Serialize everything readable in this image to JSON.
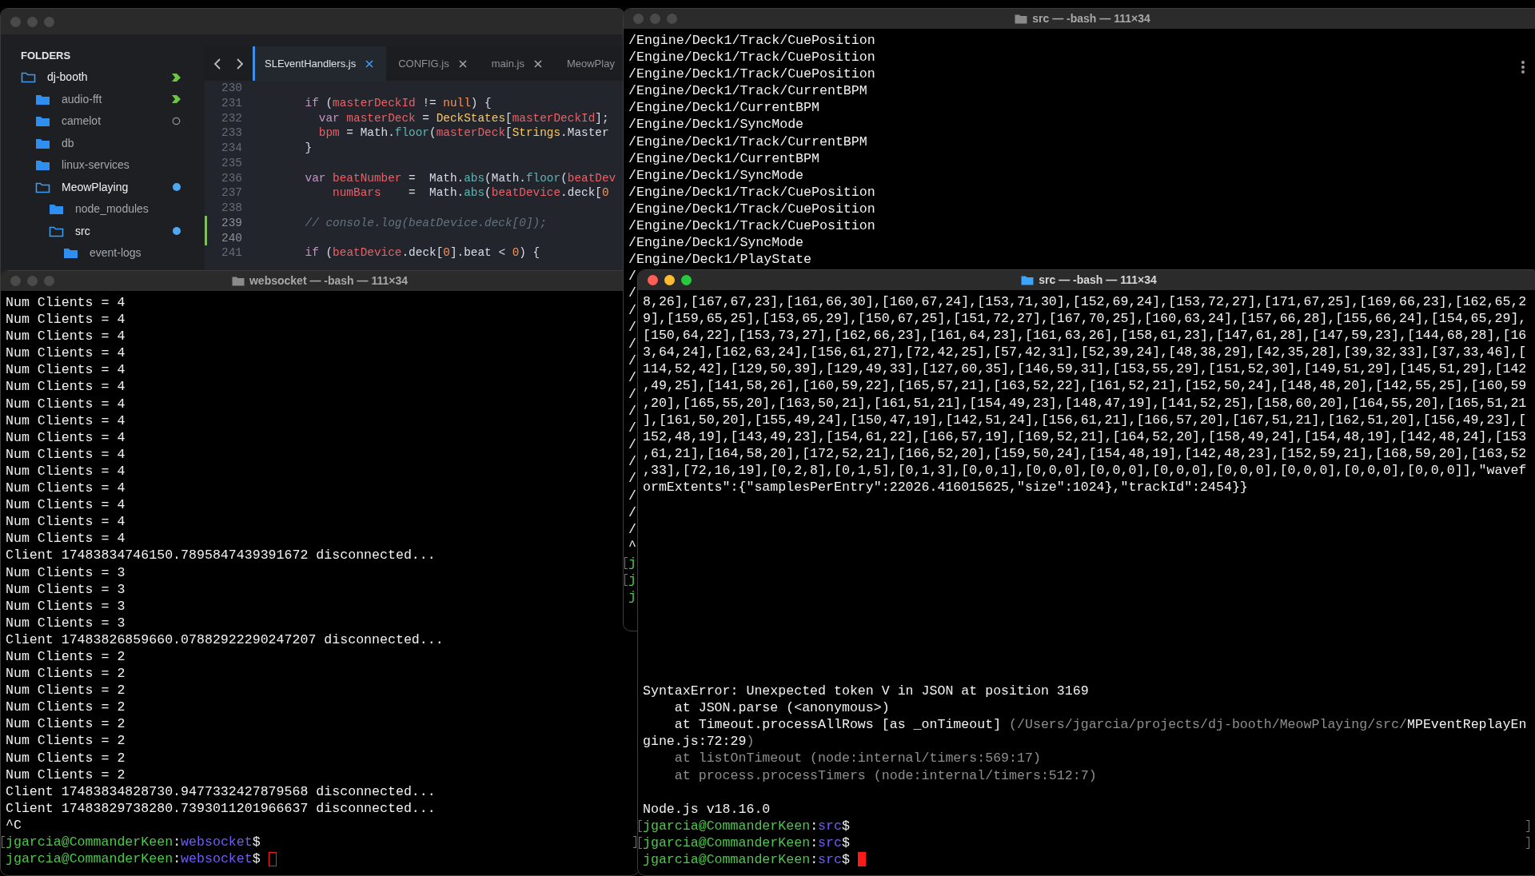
{
  "editor_window": {
    "active": false,
    "sidebar": {
      "heading": "FOLDERS",
      "tree": [
        {
          "label": "dj-booth",
          "expanded": true,
          "badge": {
            "kind": "arrow"
          },
          "children": [
            {
              "label": "audio-fft",
              "expanded": false,
              "badge": {
                "kind": "arrow"
              }
            },
            {
              "label": "camelot",
              "expanded": false,
              "badge": {
                "kind": "circle"
              }
            },
            {
              "label": "db",
              "expanded": false
            },
            {
              "label": "linux-services",
              "expanded": false
            },
            {
              "label": "MeowPlaying",
              "expanded": true,
              "badge": {
                "kind": "dot"
              },
              "children": [
                {
                  "label": "node_modules",
                  "expanded": false
                },
                {
                  "label": "src",
                  "expanded": true,
                  "badge": {
                    "kind": "dot"
                  },
                  "children": [
                    {
                      "label": "event-logs",
                      "expanded": false
                    }
                  ]
                }
              ]
            }
          ]
        }
      ]
    },
    "tabs": [
      {
        "label": "SLEventHandlers.js",
        "selected": true,
        "closable": true
      },
      {
        "label": "CONFIG.js",
        "selected": false,
        "closable": true
      },
      {
        "label": "main.js",
        "selected": false,
        "closable": true
      },
      {
        "label": "MeowPlay",
        "selected": false,
        "closable": false
      }
    ],
    "code_lines": [
      {
        "number": "230",
        "modified": false
      },
      {
        "number": "231",
        "modified": false,
        "tokens": [
          {
            "kind": "keyword",
            "text": "    if"
          },
          {
            "kind": "plain",
            "text": " ("
          },
          {
            "kind": "variable",
            "text": "masterDeckId"
          },
          {
            "kind": "plain",
            "text": " != "
          },
          {
            "kind": "constant",
            "text": "null"
          },
          {
            "kind": "plain",
            "text": ") {"
          }
        ]
      },
      {
        "number": "232",
        "modified": false,
        "tokens": [
          {
            "kind": "keyword",
            "text": "      var"
          },
          {
            "kind": "variable",
            "text": " masterDeck"
          },
          {
            "kind": "plain",
            "text": " = "
          },
          {
            "kind": "class",
            "text": "DeckStates"
          },
          {
            "kind": "plain",
            "text": "["
          },
          {
            "kind": "variable",
            "text": "masterDeckId"
          },
          {
            "kind": "plain",
            "text": "];"
          }
        ]
      },
      {
        "number": "233",
        "modified": false,
        "tokens": [
          {
            "kind": "variable",
            "text": "      bpm"
          },
          {
            "kind": "plain",
            "text": " = Math."
          },
          {
            "kind": "function",
            "text": "floor"
          },
          {
            "kind": "plain",
            "text": "("
          },
          {
            "kind": "variable",
            "text": "masterDeck"
          },
          {
            "kind": "plain",
            "text": "["
          },
          {
            "kind": "class",
            "text": "Strings"
          },
          {
            "kind": "plain",
            "text": ".Master"
          }
        ]
      },
      {
        "number": "234",
        "modified": false,
        "tokens": [
          {
            "kind": "plain",
            "text": "    }"
          }
        ]
      },
      {
        "number": "235",
        "modified": false
      },
      {
        "number": "236",
        "modified": false,
        "tokens": [
          {
            "kind": "keyword",
            "text": "    var"
          },
          {
            "kind": "variable",
            "text": " beatNumber"
          },
          {
            "kind": "plain",
            "text": " =  Math."
          },
          {
            "kind": "function",
            "text": "abs"
          },
          {
            "kind": "plain",
            "text": "(Math."
          },
          {
            "kind": "function",
            "text": "floor"
          },
          {
            "kind": "plain",
            "text": "("
          },
          {
            "kind": "variable",
            "text": "beatDev"
          }
        ]
      },
      {
        "number": "237",
        "modified": false,
        "tokens": [
          {
            "kind": "variable",
            "text": "        numBars"
          },
          {
            "kind": "plain",
            "text": "    =  Math."
          },
          {
            "kind": "function",
            "text": "abs"
          },
          {
            "kind": "plain",
            "text": "("
          },
          {
            "kind": "variable",
            "text": "beatDevice"
          },
          {
            "kind": "plain",
            "text": ".deck["
          },
          {
            "kind": "constant",
            "text": "0"
          }
        ]
      },
      {
        "number": "238",
        "modified": false
      },
      {
        "number": "239",
        "modified": true,
        "tokens": [
          {
            "kind": "comment",
            "text": "    // console.log(beatDevice.deck[0]);"
          }
        ]
      },
      {
        "number": "240",
        "modified": true
      },
      {
        "number": "241",
        "modified": false,
        "tokens": [
          {
            "kind": "keyword",
            "text": "    if"
          },
          {
            "kind": "plain",
            "text": " ("
          },
          {
            "kind": "variable",
            "text": "beatDevice"
          },
          {
            "kind": "plain",
            "text": ".deck["
          },
          {
            "kind": "constant",
            "text": "0"
          },
          {
            "kind": "plain",
            "text": "].beat < "
          },
          {
            "kind": "constant",
            "text": "0"
          },
          {
            "kind": "plain",
            "text": ") {"
          }
        ]
      }
    ]
  },
  "terminal_top_right": {
    "title": "src — -bash — 111×34",
    "active": false,
    "lines": [
      {
        "kind": "output",
        "dim": false,
        "text": "/Engine/Deck1/Track/CuePosition"
      },
      {
        "kind": "output",
        "dim": false,
        "text": "/Engine/Deck1/Track/CuePosition"
      },
      {
        "kind": "output",
        "dim": false,
        "text": "/Engine/Deck1/Track/CuePosition"
      },
      {
        "kind": "output",
        "dim": false,
        "text": "/Engine/Deck1/Track/CurrentBPM"
      },
      {
        "kind": "output",
        "dim": false,
        "text": "/Engine/Deck1/CurrentBPM"
      },
      {
        "kind": "output",
        "dim": false,
        "text": "/Engine/Deck1/SyncMode"
      },
      {
        "kind": "output",
        "dim": false,
        "text": "/Engine/Deck1/Track/CurrentBPM"
      },
      {
        "kind": "output",
        "dim": false,
        "text": "/Engine/Deck1/CurrentBPM"
      },
      {
        "kind": "output",
        "dim": false,
        "text": "/Engine/Deck1/SyncMode"
      },
      {
        "kind": "output",
        "dim": false,
        "text": "/Engine/Deck1/Track/CuePosition"
      },
      {
        "kind": "output",
        "dim": false,
        "text": "/Engine/Deck1/Track/CuePosition"
      },
      {
        "kind": "output",
        "dim": false,
        "text": "/Engine/Deck1/Track/CuePosition"
      },
      {
        "kind": "output",
        "dim": false,
        "text": "/Engine/Deck1/SyncMode"
      },
      {
        "kind": "output",
        "dim": false,
        "text": "/Engine/Deck1/PlayState"
      },
      {
        "kind": "output",
        "dim": false,
        "text": "/"
      },
      {
        "kind": "output",
        "dim": false,
        "text": "/"
      },
      {
        "kind": "output",
        "dim": false,
        "text": "/"
      },
      {
        "kind": "output",
        "dim": false,
        "text": "/"
      },
      {
        "kind": "output",
        "dim": false,
        "text": "/"
      },
      {
        "kind": "output",
        "dim": false,
        "text": "/"
      },
      {
        "kind": "output",
        "dim": false,
        "text": "/"
      },
      {
        "kind": "output",
        "dim": false,
        "text": "/"
      },
      {
        "kind": "output",
        "dim": false,
        "text": "/"
      },
      {
        "kind": "output",
        "dim": false,
        "text": "/"
      },
      {
        "kind": "output",
        "dim": false,
        "text": "/"
      },
      {
        "kind": "output",
        "dim": false,
        "text": "/"
      },
      {
        "kind": "output",
        "dim": false,
        "text": "/"
      },
      {
        "kind": "output",
        "dim": false,
        "text": "/"
      },
      {
        "kind": "output",
        "dim": false,
        "text": "/"
      },
      {
        "kind": "output",
        "dim": false,
        "text": "/"
      },
      {
        "kind": "output",
        "dim": false,
        "text": "^"
      },
      {
        "kind": "prompt_fragment",
        "user": "j",
        "marked": true
      },
      {
        "kind": "prompt_fragment",
        "user": "j",
        "marked": true
      },
      {
        "kind": "prompt_fragment",
        "user": "j"
      }
    ]
  },
  "terminal_websocket": {
    "title": "websocket — -bash — 111×34",
    "active": false,
    "lines": [
      {
        "kind": "output",
        "dim": false,
        "text": "Num Clients = 4"
      },
      {
        "kind": "output",
        "dim": false,
        "text": "Num Clients = 4"
      },
      {
        "kind": "output",
        "dim": false,
        "text": "Num Clients = 4"
      },
      {
        "kind": "output",
        "dim": false,
        "text": "Num Clients = 4"
      },
      {
        "kind": "output",
        "dim": false,
        "text": "Num Clients = 4"
      },
      {
        "kind": "output",
        "dim": false,
        "text": "Num Clients = 4"
      },
      {
        "kind": "output",
        "dim": false,
        "text": "Num Clients = 4"
      },
      {
        "kind": "output",
        "dim": false,
        "text": "Num Clients = 4"
      },
      {
        "kind": "output",
        "dim": false,
        "text": "Num Clients = 4"
      },
      {
        "kind": "output",
        "dim": false,
        "text": "Num Clients = 4"
      },
      {
        "kind": "output",
        "dim": false,
        "text": "Num Clients = 4"
      },
      {
        "kind": "output",
        "dim": false,
        "text": "Num Clients = 4"
      },
      {
        "kind": "output",
        "dim": false,
        "text": "Num Clients = 4"
      },
      {
        "kind": "output",
        "dim": false,
        "text": "Num Clients = 4"
      },
      {
        "kind": "output",
        "dim": false,
        "text": "Num Clients = 4"
      },
      {
        "kind": "output",
        "dim": false,
        "text": "Client 17483834746150.7895847439391672 disconnected..."
      },
      {
        "kind": "output",
        "dim": false,
        "text": "Num Clients = 3"
      },
      {
        "kind": "output",
        "dim": false,
        "text": "Num Clients = 3"
      },
      {
        "kind": "output",
        "dim": false,
        "text": "Num Clients = 3"
      },
      {
        "kind": "output",
        "dim": false,
        "text": "Num Clients = 3"
      },
      {
        "kind": "output",
        "dim": false,
        "text": "Client 17483826859660.07882922290247207 disconnected..."
      },
      {
        "kind": "output",
        "dim": false,
        "text": "Num Clients = 2"
      },
      {
        "kind": "output",
        "dim": false,
        "text": "Num Clients = 2"
      },
      {
        "kind": "output",
        "dim": false,
        "text": "Num Clients = 2"
      },
      {
        "kind": "output",
        "dim": false,
        "text": "Num Clients = 2"
      },
      {
        "kind": "output",
        "dim": false,
        "text": "Num Clients = 2"
      },
      {
        "kind": "output",
        "dim": false,
        "text": "Num Clients = 2"
      },
      {
        "kind": "output",
        "dim": false,
        "text": "Num Clients = 2"
      },
      {
        "kind": "output",
        "dim": false,
        "text": "Num Clients = 2"
      },
      {
        "kind": "output",
        "dim": false,
        "text": "Client 17483834828730.9477332427879568 disconnected..."
      },
      {
        "kind": "output",
        "dim": false,
        "text": "Client 17483829738280.7393011201966637 disconnected..."
      },
      {
        "kind": "output",
        "dim": false,
        "text": "^C"
      },
      {
        "kind": "prompt",
        "user": "jgarcia@CommanderKeen",
        "sep": ":",
        "dir": "websocket",
        "symbol": "$",
        "marked": true
      },
      {
        "kind": "prompt",
        "user": "jgarcia@CommanderKeen",
        "sep": ":",
        "dir": "websocket",
        "symbol": "$",
        "cursor": {
          "kind": "hollow"
        }
      }
    ]
  },
  "terminal_bottom_right": {
    "title": "src — -bash — 111×34",
    "active": true,
    "output_lines": [
      {
        "kind": "output",
        "dim": false,
        "text": "8,26],[167,67,23],[161,66,30],[160,67,24],[153,71,30],[152,69,24],[153,72,27],[171,67,25],[169,66,23],[162,65,2"
      },
      {
        "kind": "output",
        "dim": false,
        "text": "9],[159,65,25],[153,65,29],[150,67,25],[151,72,27],[167,70,25],[160,63,24],[157,66,28],[155,66,24],[154,65,29],"
      },
      {
        "kind": "output",
        "dim": false,
        "text": "[150,64,22],[153,73,27],[162,66,23],[161,64,23],[161,63,26],[158,61,23],[147,61,28],[147,59,23],[144,68,28],[16"
      },
      {
        "kind": "output",
        "dim": false,
        "text": "3,64,24],[162,63,24],[156,61,27],[72,42,25],[57,42,31],[52,39,24],[48,38,29],[42,35,28],[39,32,33],[37,33,46],["
      },
      {
        "kind": "output",
        "dim": false,
        "text": "114,52,42],[129,50,39],[129,49,33],[127,60,35],[146,59,31],[153,55,29],[151,52,30],[149,51,29],[145,51,29],[142"
      },
      {
        "kind": "output",
        "dim": false,
        "text": ",49,25],[141,58,26],[160,59,22],[165,57,21],[163,52,22],[161,52,21],[152,50,24],[148,48,20],[142,55,25],[160,59"
      },
      {
        "kind": "output",
        "dim": false,
        "text": ",20],[165,55,20],[163,50,21],[161,51,21],[154,49,23],[148,47,19],[141,52,25],[158,60,20],[164,55,20],[165,51,21"
      },
      {
        "kind": "output",
        "dim": false,
        "text": "],[161,50,20],[155,49,24],[150,47,19],[142,51,24],[156,61,21],[166,57,20],[167,51,21],[162,51,20],[156,49,23],["
      },
      {
        "kind": "output",
        "dim": false,
        "text": "152,48,19],[143,49,23],[154,61,22],[166,57,19],[169,52,21],[164,52,20],[158,49,24],[154,48,19],[142,48,24],[153"
      },
      {
        "kind": "output",
        "dim": false,
        "text": ",61,21],[164,58,20],[172,52,21],[166,52,20],[159,50,24],[154,48,19],[142,48,23],[152,59,21],[168,59,20],[163,52"
      },
      {
        "kind": "output",
        "dim": false,
        "text": ",33],[72,16,19],[0,2,8],[0,1,5],[0,1,3],[0,0,1],[0,0,0],[0,0,0],[0,0,0],[0,0,0],[0,0,0],[0,0,0],[0,0,0]],\"wavef"
      },
      {
        "kind": "output",
        "dim": false,
        "text": "ormExtents\":{\"samplesPerEntry\":22026.416015625,\"size\":1024},\"trackId\":2454}}"
      }
    ],
    "error_lines": [
      {
        "kind": "output",
        "dim": false,
        "text": "SyntaxError: Unexpected token V in JSON at position 3169"
      },
      {
        "kind": "output",
        "dim": false,
        "text": "    at JSON.parse (<anonymous>)"
      },
      {
        "kind": "mixed",
        "segments": [
          {
            "dim": false,
            "text": "    at Timeout.processAllRows [as _onTimeout] "
          },
          {
            "dim": true,
            "text": "(/Users/jgarcia/projects/dj-booth/MeowPlaying/src/"
          },
          {
            "dim": false,
            "text": "MPEventReplayEn"
          }
        ]
      },
      {
        "kind": "mixed",
        "segments": [
          {
            "dim": false,
            "text": "gine.js:72:29"
          },
          {
            "dim": true,
            "text": ")"
          }
        ]
      },
      {
        "kind": "output",
        "dim": true,
        "text": "    at listOnTimeout (node:internal/timers:569:17)"
      },
      {
        "kind": "output",
        "dim": true,
        "text": "    at process.processTimers (node:internal/timers:512:7)"
      }
    ],
    "footer_lines": [
      {
        "kind": "output",
        "dim": false,
        "text": "Node.js v18.16.0"
      },
      {
        "kind": "prompt",
        "user": "jgarcia@CommanderKeen",
        "sep": ":",
        "dir": "src",
        "symbol": "$",
        "marked": true
      },
      {
        "kind": "prompt",
        "user": "jgarcia@CommanderKeen",
        "sep": ":",
        "dir": "src",
        "symbol": "$",
        "marked": true
      },
      {
        "kind": "prompt",
        "user": "jgarcia@CommanderKeen",
        "sep": ":",
        "dir": "src",
        "symbol": "$",
        "cursor": {
          "kind": "filled"
        }
      }
    ]
  }
}
